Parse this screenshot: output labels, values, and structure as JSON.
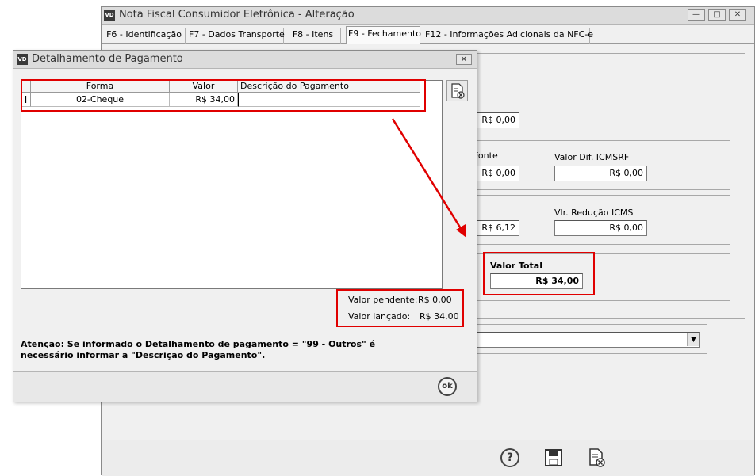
{
  "main_window": {
    "icon": "VD",
    "title": "Nota Fiscal Consumidor Eletrônica - Alteração",
    "controls": [
      "minimize-icon",
      "maximize-icon",
      "close-icon"
    ],
    "tabs": [
      {
        "label": "F6 - Identificação",
        "active": false
      },
      {
        "label": "F7 - Dados Transporte",
        "active": false
      },
      {
        "label": "F8 - Itens",
        "active": false
      },
      {
        "label": "F9 - Fechamento",
        "active": true
      },
      {
        "label": "F12 - Informações Adicionais da NFC-e",
        "active": false
      }
    ],
    "fields": {
      "field1_value": "R$ 0,00",
      "fonte_label": "Fonte",
      "fonte_value": "R$ 0,00",
      "dif_icmsrf_label": "Valor Dif. ICMSRF",
      "dif_icmsrf_value": "R$ 0,00",
      "field5_value": "R$ 6,12",
      "reducao_icms_label": "Vlr. Redução ICMS",
      "reducao_icms_value": "R$ 0,00",
      "valor_total_label": "Valor Total",
      "valor_total_value": "R$ 34,00",
      "dropdown_value": ""
    },
    "footer_icons": [
      "help-icon",
      "save-icon",
      "cancel-document-icon"
    ]
  },
  "dialog": {
    "icon": "VD",
    "title": "Detalhamento de Pagamento",
    "close_icon": "close-icon",
    "grid": {
      "headers": [
        "Forma",
        "Valor",
        "Descrição do Pagamento"
      ],
      "rows": [
        {
          "forma": "02-Cheque",
          "valor": "R$ 34,00",
          "descricao": ""
        }
      ]
    },
    "side_button_icon": "delete-document-icon",
    "valor_pendente_label": "Valor pendente:",
    "valor_pendente_value": "R$ 0,00",
    "valor_lancado_label": "Valor lançado:",
    "valor_lancado_value": "R$ 34,00",
    "warning_line1": "Atenção: Se informado o Detalhamento de pagamento = \"99 - Outros\" é",
    "warning_line2": "necessário informar a \"Descrição do Pagamento\".",
    "ok_label": "ok"
  },
  "annotation_color": "#e00000"
}
